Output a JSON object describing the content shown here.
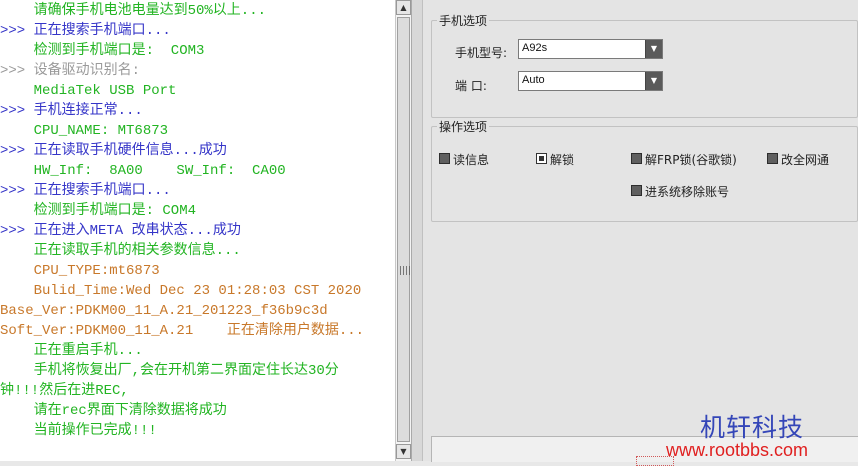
{
  "log": {
    "lines": [
      {
        "text": "    请确保手机电池电量达到50%以上...",
        "color": "green"
      },
      {
        "text": ">>> 正在搜索手机端口...",
        "color": "blue"
      },
      {
        "text": "    检测到手机端口是:  COM3",
        "color": "green"
      },
      {
        "text": ">>> 设备驱动识别名:",
        "color": "gray"
      },
      {
        "text": "    MediaTek USB Port",
        "color": "green"
      },
      {
        "text": ">>> 手机连接正常...",
        "color": "blue"
      },
      {
        "text": "    CPU_NAME: MT6873",
        "color": "green"
      },
      {
        "text": ">>> 正在读取手机硬件信息...成功",
        "color": "blue"
      },
      {
        "text": "    HW_Inf:  8A00    SW_Inf:  CA00",
        "color": "green"
      },
      {
        "text": ">>> 正在搜索手机端口...",
        "color": "blue"
      },
      {
        "text": "    检测到手机端口是: COM4",
        "color": "green"
      },
      {
        "text": ">>> 正在进入META 改串状态...成功",
        "color": "blue"
      },
      {
        "text": "    正在读取手机的相关参数信息...",
        "color": "green"
      },
      {
        "text": "    CPU_TYPE:mt6873",
        "color": "orange"
      },
      {
        "text": "    Bulid_Time:Wed Dec 23 01:28:03 CST 2020",
        "color": "orange"
      },
      {
        "text": "Base_Ver:PDKM00_11_A.21_201223_f36b9c3d",
        "color": "orange"
      },
      {
        "text": "Soft_Ver:PDKM00_11_A.21    正在清除用户数据...",
        "color": "orange"
      },
      {
        "text": "    正在重启手机...",
        "color": "green"
      },
      {
        "text": "    手机将恢复出厂,会在开机第二界面定住长达30分",
        "color": "green"
      },
      {
        "text": "钟!!!然后在进REC,",
        "color": "green"
      },
      {
        "text": "    请在rec界面下清除数据将成功",
        "color": "green"
      },
      {
        "text": "    当前操作已完成!!!",
        "color": "green"
      }
    ]
  },
  "colors": {
    "blue": "#3535c8",
    "green": "#22b422",
    "gray": "#9a9a9a",
    "orange": "#c8782a"
  },
  "phone_options": {
    "title": "手机选项",
    "model_label": "手机型号:",
    "model_value": "A92s",
    "port_label": "端    口:",
    "port_value": "Auto"
  },
  "operation_options": {
    "title": "操作选项",
    "items": [
      {
        "label": "读信息",
        "checked": false
      },
      {
        "label": "解锁",
        "checked": true
      },
      {
        "label": "解FRP锁(谷歌锁)",
        "checked": false
      },
      {
        "label": "改全网通",
        "checked": false
      },
      {
        "label": "进系统移除账号",
        "checked": false
      }
    ]
  },
  "watermark": {
    "company": "机轩科技",
    "url": "www.rootbbs.com"
  },
  "icons": {
    "scroll_up": "triangle-up-icon",
    "scroll_down": "triangle-down-icon",
    "combo_arrow": "chevron-down-icon",
    "thumb_grip": "grip-icon"
  }
}
